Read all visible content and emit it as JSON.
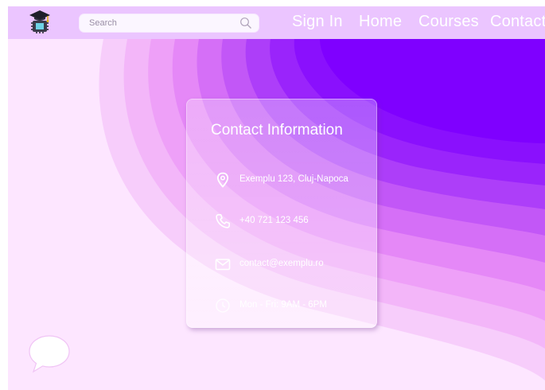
{
  "colors": {
    "background_light": "#fde6ff",
    "accent_purple": "#7f00ff",
    "navbar": "#dcaaff",
    "text_white": "#ffffff"
  },
  "navbar": {
    "logo_icon": "graduation-cap-circuit-icon",
    "search": {
      "placeholder": "Search",
      "value": "",
      "icon": "search-icon"
    },
    "links": [
      "Sign In",
      "Home",
      "Courses",
      "Contact"
    ]
  },
  "contact_card": {
    "title": "Contact Information",
    "items": [
      {
        "icon": "location-pin-icon",
        "text": "Exemplu 123, Cluj-Napoca"
      },
      {
        "icon": "phone-icon",
        "text": "+40 721 123 456"
      },
      {
        "icon": "mail-icon",
        "text": "contact@exemplu.ro"
      },
      {
        "icon": "clock-icon",
        "text": "Mon - Fri: 9AM - 6PM"
      }
    ]
  },
  "chat_widget": {
    "icon": "chat-bubble-icon"
  }
}
